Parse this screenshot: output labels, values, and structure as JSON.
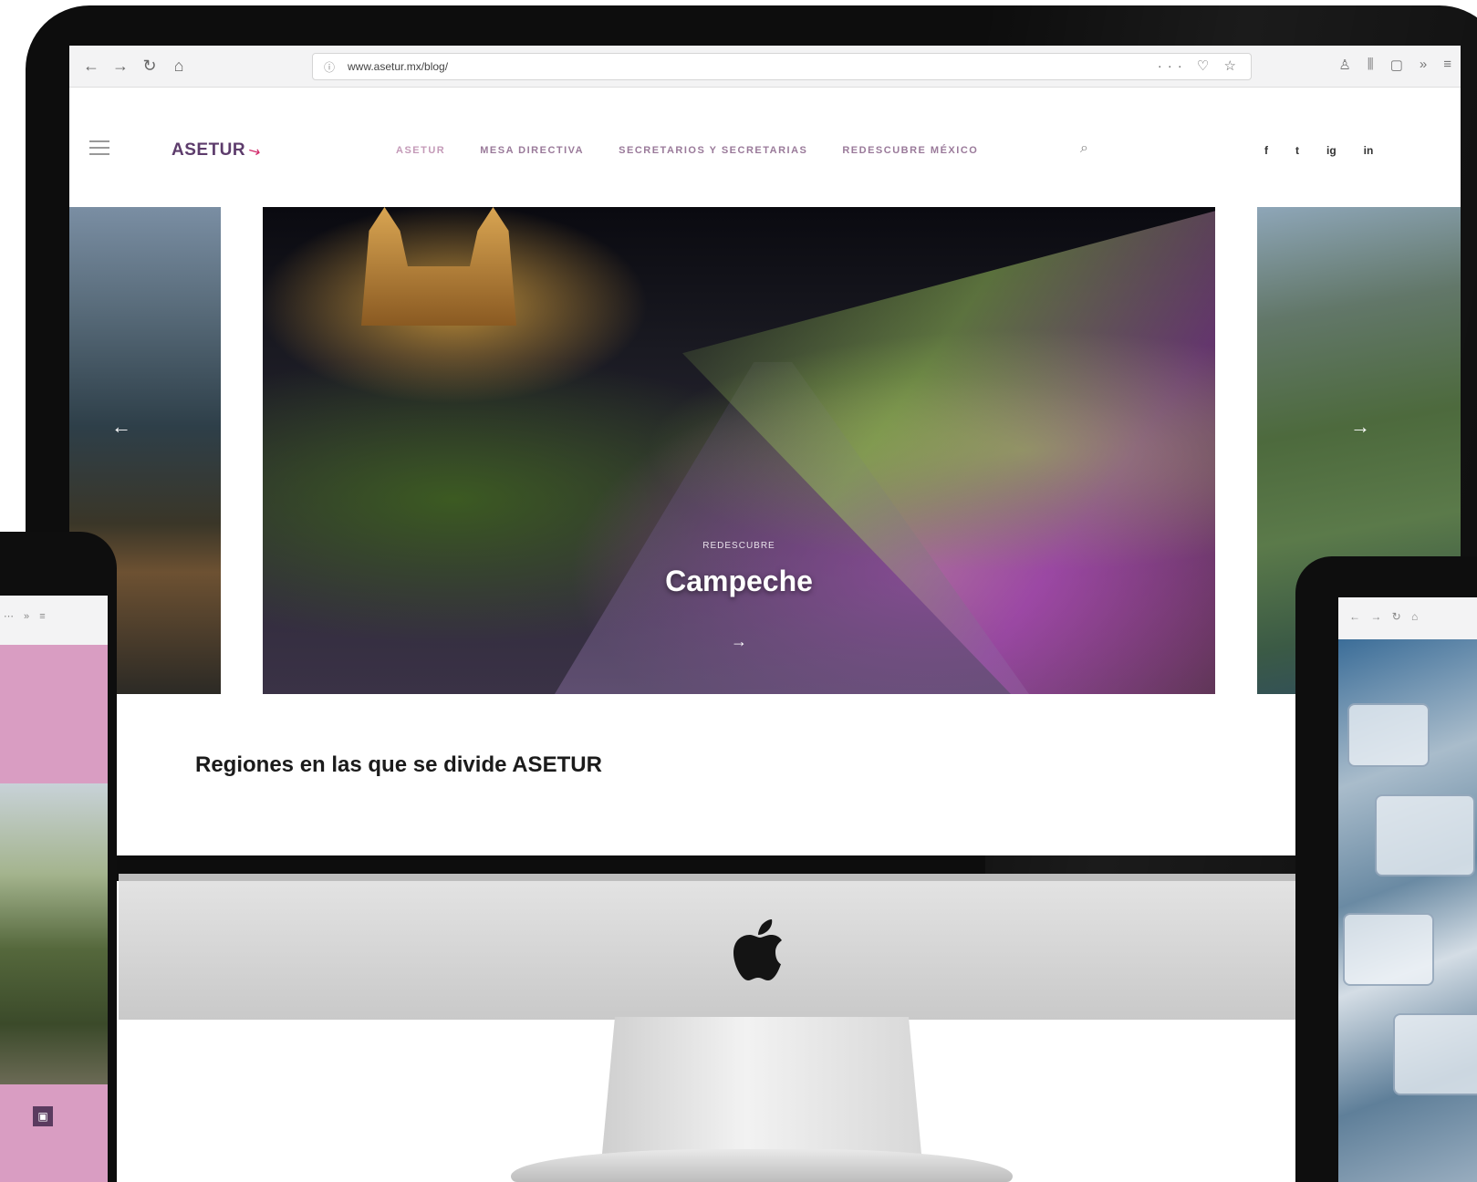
{
  "browser": {
    "url": "www.asetur.mx/blog/",
    "nav_icons": [
      "back-arrow-icon",
      "forward-arrow-icon",
      "reload-icon",
      "home-icon"
    ],
    "url_actions": "··· ♡ ☆",
    "toolbar_icons": [
      "profile-icon",
      "library-icon",
      "sidebar-icon",
      "extension-icon",
      "menu-icon"
    ]
  },
  "site": {
    "logo": "ASETUR",
    "menu": [
      "ASETUR",
      "MESA DIRECTIVA",
      "SECRETARIOS Y SECRETARIAS",
      "REDESCUBRE MÉXICO"
    ],
    "social": [
      "f",
      "t",
      "ig",
      "in"
    ]
  },
  "slider": {
    "kicker": "REDESCUBRE",
    "title": "Campeche",
    "arrow": "→",
    "prev": "←",
    "next": "→"
  },
  "sections": {
    "regions_heading": "Regiones en las que se divide ASETUR"
  },
  "colors": {
    "logo": "#5d3c6c",
    "accent": "#d22a6a",
    "menu": "#9a7a9a",
    "pink_panel": "#d99dc2"
  }
}
